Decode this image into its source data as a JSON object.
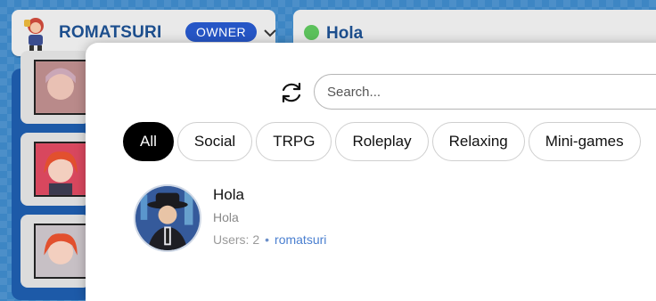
{
  "user": {
    "name": "ROMATSURI",
    "role_badge": "OWNER"
  },
  "room_tab": {
    "title": "Hola",
    "status_color": "#5cc15c"
  },
  "search": {
    "placeholder": "Search..."
  },
  "filters": [
    {
      "label": "All",
      "active": true
    },
    {
      "label": "Social"
    },
    {
      "label": "TRPG"
    },
    {
      "label": "Roleplay"
    },
    {
      "label": "Relaxing"
    },
    {
      "label": "Mini-games"
    }
  ],
  "rooms": [
    {
      "name": "Hola",
      "description": "Hola",
      "users_label": "Users: 2",
      "separator": "•",
      "owner": "romatsuri"
    }
  ],
  "icons": {
    "refresh": "refresh-icon",
    "chevron": "chevron-down-icon"
  },
  "colors": {
    "accent": "#2656c6",
    "title_blue": "#1d4f8e",
    "online": "#5cc15c"
  }
}
